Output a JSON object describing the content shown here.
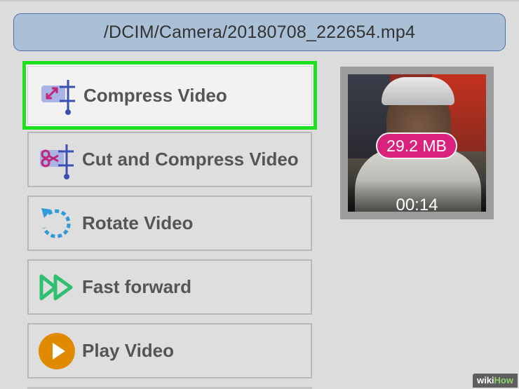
{
  "path_bar": {
    "text": "/DCIM/Camera/20180708_222654.mp4"
  },
  "menu": {
    "items": [
      {
        "label": "Compress Video",
        "icon": "compress-icon",
        "selected": true
      },
      {
        "label": "Cut and Compress Video",
        "icon": "cut-compress-icon",
        "selected": false
      },
      {
        "label": "Rotate Video",
        "icon": "rotate-icon",
        "selected": false
      },
      {
        "label": "Fast forward",
        "icon": "fast-forward-icon",
        "selected": false
      },
      {
        "label": "Play Video",
        "icon": "play-icon",
        "selected": false
      }
    ]
  },
  "thumbnail": {
    "size": "29.2 MB",
    "duration": "00:14"
  },
  "watermark": {
    "prefix": "wiki",
    "suffix": "How"
  },
  "colors": {
    "selected_border": "#1ee01e",
    "path_bar_bg": "#a9c0d6",
    "size_badge": "#d8227c",
    "icon_blue": "#3a4fb0",
    "icon_magenta": "#c0267a",
    "rotate_blue": "#2e9bd6",
    "fast_forward_green": "#2fbf71",
    "play_orange": "#e08a00"
  }
}
